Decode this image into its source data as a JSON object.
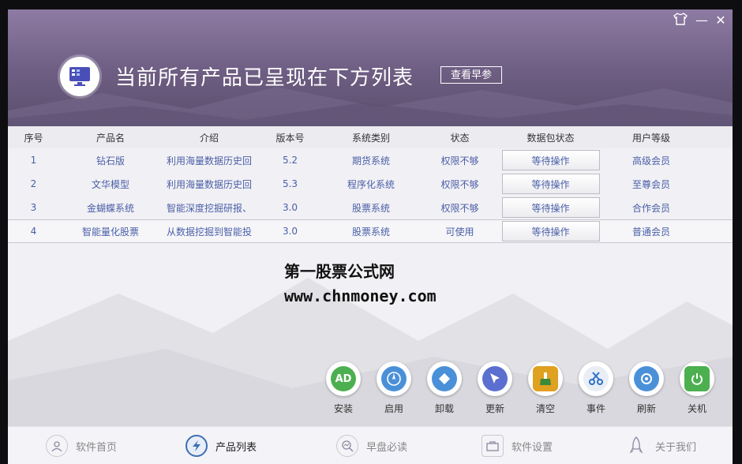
{
  "window": {
    "skin_icon": "shirt-icon",
    "min_label": "—",
    "close_label": "✕"
  },
  "header": {
    "title": "当前所有产品已呈现在下方列表",
    "report_button": "查看早参",
    "logo_icon": "monitor-icon"
  },
  "table": {
    "headers": [
      "序号",
      "产品名",
      "介绍",
      "版本号",
      "系统类别",
      "状态",
      "数据包状态",
      "用户等级"
    ],
    "rows": [
      {
        "no": "1",
        "name": "钻石版",
        "intro": "利用海量数据历史回",
        "version": "5.2",
        "category": "期货系统",
        "status": "权限不够",
        "pkg": "等待操作",
        "level": "高级会员"
      },
      {
        "no": "2",
        "name": "文华模型",
        "intro": "利用海量数据历史回",
        "version": "5.3",
        "category": "程序化系统",
        "status": "权限不够",
        "pkg": "等待操作",
        "level": "至尊会员"
      },
      {
        "no": "3",
        "name": "金蝴蝶系统",
        "intro": "智能深度挖掘研报、",
        "version": "3.0",
        "category": "股票系统",
        "status": "权限不够",
        "pkg": "等待操作",
        "level": "合作会员"
      },
      {
        "no": "4",
        "name": "智能量化股票",
        "intro": "从数据挖掘到智能投",
        "version": "3.0",
        "category": "股票系统",
        "status": "可使用",
        "pkg": "等待操作",
        "level": "普通会员"
      }
    ]
  },
  "watermark": {
    "line1": "第一股票公式网",
    "line2": "www.chnmoney.com"
  },
  "actions": [
    {
      "label": "安装",
      "icon": "ad-install-icon",
      "color": "#4caf50"
    },
    {
      "label": "启用",
      "icon": "compass-icon",
      "color": "#4a90d9"
    },
    {
      "label": "卸载",
      "icon": "eraser-icon",
      "color": "#4a90d9"
    },
    {
      "label": "更新",
      "icon": "cursor-icon",
      "color": "#5b6fd0"
    },
    {
      "label": "清空",
      "icon": "broom-icon",
      "color": "#e0a020"
    },
    {
      "label": "事件",
      "icon": "scissors-icon",
      "color": "#4a90d9"
    },
    {
      "label": "刷新",
      "icon": "refresh-icon",
      "color": "#4a90d9"
    },
    {
      "label": "关机",
      "icon": "power-icon",
      "color": "#4caf50"
    }
  ],
  "nav": [
    {
      "label": "软件首页",
      "icon": "user-icon"
    },
    {
      "label": "产品列表",
      "icon": "lightning-icon"
    },
    {
      "label": "早盘必读",
      "icon": "search-chart-icon"
    },
    {
      "label": "软件设置",
      "icon": "toolbox-icon"
    },
    {
      "label": "关于我们",
      "icon": "rocket-icon"
    }
  ]
}
